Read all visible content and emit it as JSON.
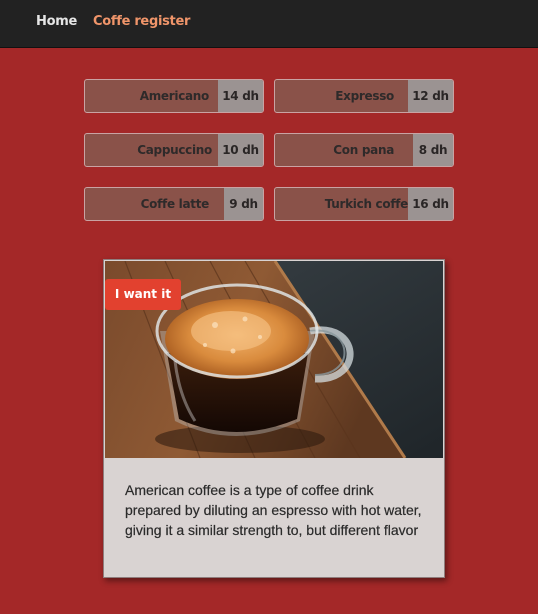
{
  "nav": {
    "home_label": "Home",
    "register_label": "Coffe register"
  },
  "menu": [
    {
      "name": "Americano",
      "price": "14 dh"
    },
    {
      "name": "Expresso",
      "price": "12 dh"
    },
    {
      "name": "Cappuccino",
      "price": "10 dh"
    },
    {
      "name": "Con pana",
      "price": "8 dh"
    },
    {
      "name": "Coffe latte",
      "price": "9 dh"
    },
    {
      "name": "Turkich coffe",
      "price": "16 dh"
    }
  ],
  "card": {
    "image": "espresso-cup-photo",
    "button_label": "I want it",
    "description": "American coffee is a type of coffee drink prepared by diluting an espresso with hot water, giving it a similar strength to, but different flavor"
  },
  "colors": {
    "page_background": "#a42828",
    "navbar": "#222222",
    "accent_link": "#f0956a",
    "button_red": "#e2412f"
  }
}
